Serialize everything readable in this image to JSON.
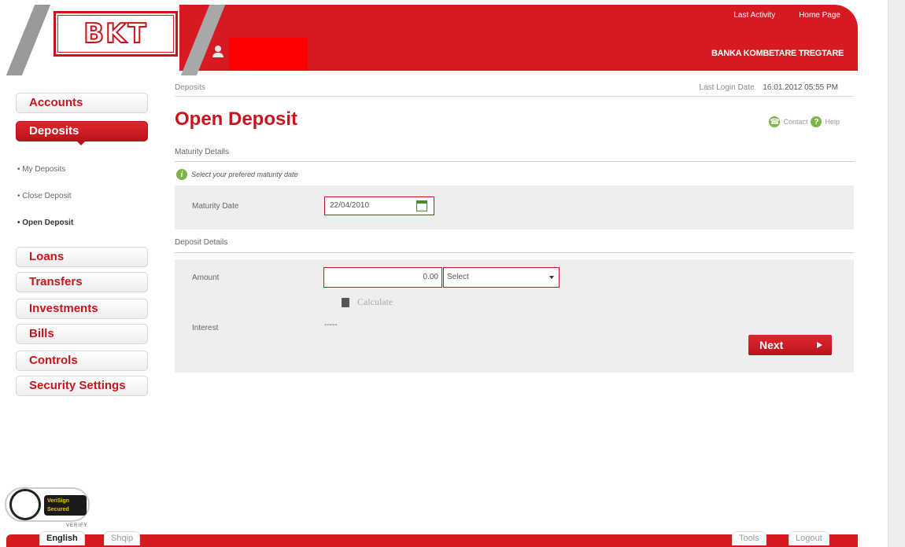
{
  "header": {
    "logo_text": "BKT",
    "last_activity": "Last Activity",
    "home_page": "Home Page",
    "bank_name": "BANKA KOMBETARE TREGTARE"
  },
  "sidebar": {
    "nav": [
      {
        "label": "Accounts"
      },
      {
        "label": "Deposits"
      },
      {
        "label": "Loans"
      },
      {
        "label": "Transfers"
      },
      {
        "label": "Investments"
      },
      {
        "label": "Bills"
      },
      {
        "label": "Controls"
      },
      {
        "label": "Security Settings"
      }
    ],
    "sub": [
      {
        "label": "• My Deposits"
      },
      {
        "label": "• Close Deposit"
      },
      {
        "label": "• Open Deposit"
      }
    ]
  },
  "main": {
    "breadcrumb": "Deposits",
    "last_login_label": "Last Login Date",
    "last_login_value": "16.01.2012 05:55 PM",
    "title": "Open Deposit",
    "contact": "Contact",
    "help": "Help",
    "maturity_section": "Maturity Details",
    "maturity_info": "Select your prefered maturity date",
    "maturity_date_label": "Maturity Date",
    "maturity_date_value": "22/04/2010",
    "deposit_section": "Deposit Details",
    "amount_label": "Amount",
    "amount_value": "0.00",
    "currency_value": "Select",
    "calculate": "Calculate",
    "interest_label": "Interest",
    "interest_value": "-----",
    "next": "Next"
  },
  "verisign": {
    "line1": "VeriSign",
    "line2": "Secured",
    "verify": "VERIFY"
  },
  "footer": {
    "english": "English",
    "shqip": "Shqip",
    "tools": "Tools",
    "logout": "Logout"
  },
  "colors": {
    "brand_red": "#d71921",
    "help_green": "#7eb34a"
  }
}
